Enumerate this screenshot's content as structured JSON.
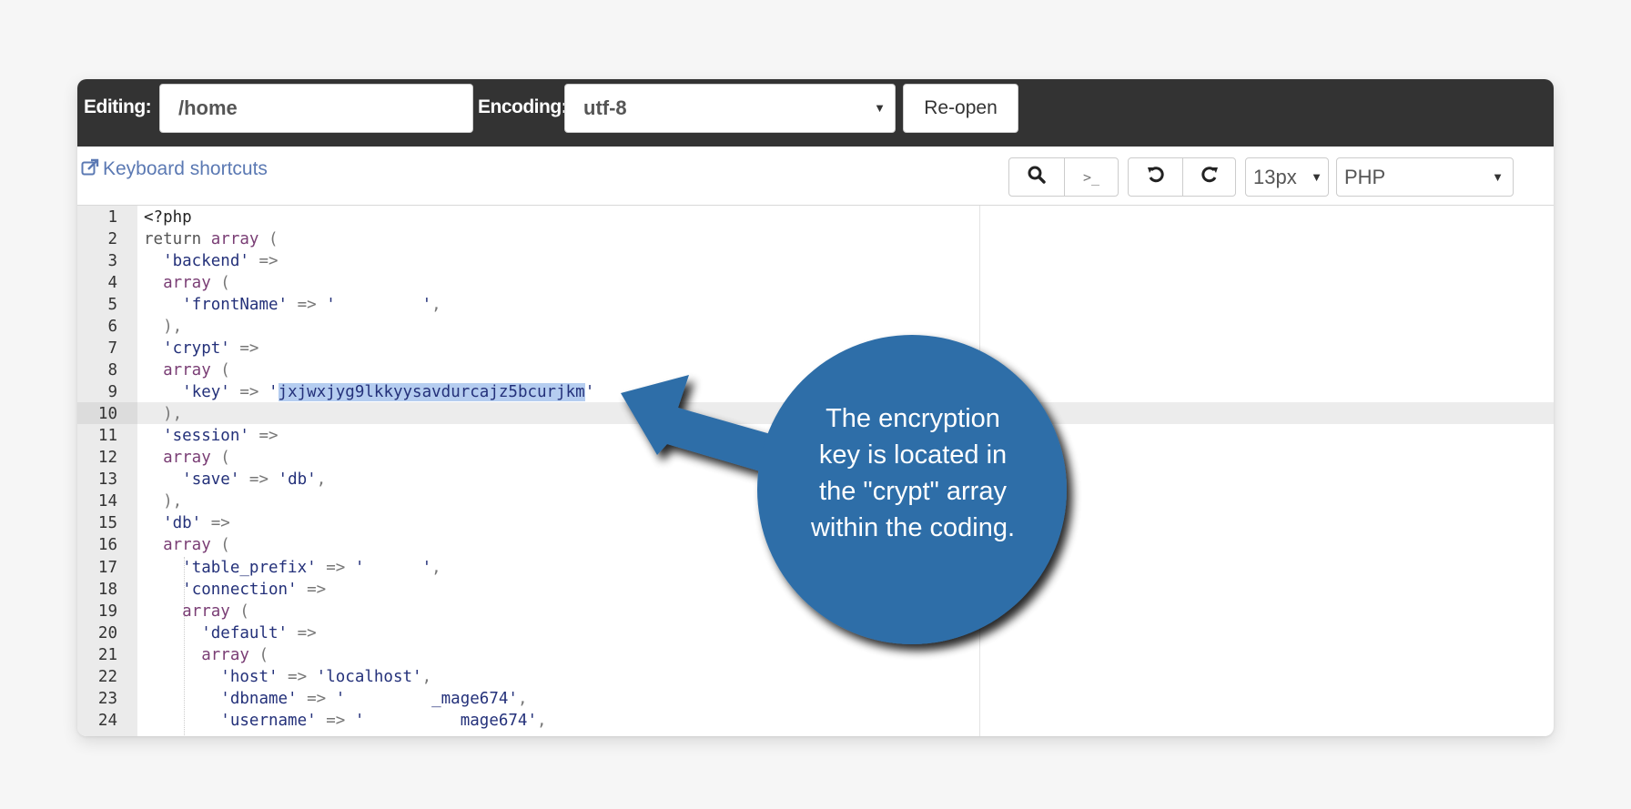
{
  "header": {
    "editing_label": "Editing:",
    "editing_path": "/home",
    "encoding_label": "Encoding:",
    "encoding_value": "utf-8",
    "reopen_label": "Re-open"
  },
  "toolbar": {
    "keyboard_shortcuts_label": "Keyboard shortcuts",
    "search_icon": "search-icon",
    "terminal_icon": "terminal-icon",
    "terminal_glyph": ">_",
    "undo_icon": "undo-icon",
    "redo_icon": "redo-icon",
    "font_size_value": "13px",
    "language_value": "PHP"
  },
  "editor": {
    "active_line": 9,
    "lines": [
      {
        "n": "1",
        "tokens": [
          {
            "t": "tag",
            "v": "<?php"
          }
        ]
      },
      {
        "n": "2",
        "tokens": [
          {
            "t": "kw",
            "v": "return "
          },
          {
            "t": "fn",
            "v": "array"
          },
          {
            "t": "op",
            "v": " ("
          }
        ]
      },
      {
        "n": "3",
        "tokens": [
          {
            "t": "op",
            "v": "  "
          },
          {
            "t": "str",
            "v": "'backend'"
          },
          {
            "t": "op",
            "v": " =>"
          }
        ]
      },
      {
        "n": "4",
        "tokens": [
          {
            "t": "op",
            "v": "  "
          },
          {
            "t": "fn",
            "v": "array"
          },
          {
            "t": "op",
            "v": " ("
          }
        ]
      },
      {
        "n": "5",
        "tokens": [
          {
            "t": "op",
            "v": "    "
          },
          {
            "t": "str",
            "v": "'frontName'"
          },
          {
            "t": "op",
            "v": " => "
          },
          {
            "t": "str",
            "v": "'         '"
          },
          {
            "t": "op",
            "v": ","
          }
        ]
      },
      {
        "n": "6",
        "tokens": [
          {
            "t": "op",
            "v": "  ),"
          }
        ]
      },
      {
        "n": "7",
        "tokens": [
          {
            "t": "op",
            "v": "  "
          },
          {
            "t": "str",
            "v": "'crypt'"
          },
          {
            "t": "op",
            "v": " =>"
          }
        ]
      },
      {
        "n": "8",
        "tokens": [
          {
            "t": "op",
            "v": "  "
          },
          {
            "t": "fn",
            "v": "array"
          },
          {
            "t": "op",
            "v": " ("
          }
        ]
      },
      {
        "n": "9",
        "tokens": [
          {
            "t": "op",
            "v": "    "
          },
          {
            "t": "str",
            "v": "'key'"
          },
          {
            "t": "op",
            "v": " => "
          },
          {
            "t": "str",
            "v": "'"
          },
          {
            "t": "sel",
            "v": "jxjwxjyg9lkkyysavdurcajz5bcurjkm"
          },
          {
            "t": "str",
            "v": "'"
          }
        ]
      },
      {
        "n": "10",
        "tokens": [
          {
            "t": "op",
            "v": "  ),"
          }
        ]
      },
      {
        "n": "11",
        "tokens": [
          {
            "t": "op",
            "v": "  "
          },
          {
            "t": "str",
            "v": "'session'"
          },
          {
            "t": "op",
            "v": " =>"
          }
        ]
      },
      {
        "n": "12",
        "tokens": [
          {
            "t": "op",
            "v": "  "
          },
          {
            "t": "fn",
            "v": "array"
          },
          {
            "t": "op",
            "v": " ("
          }
        ]
      },
      {
        "n": "13",
        "tokens": [
          {
            "t": "op",
            "v": "    "
          },
          {
            "t": "str",
            "v": "'save'"
          },
          {
            "t": "op",
            "v": " => "
          },
          {
            "t": "str",
            "v": "'db'"
          },
          {
            "t": "op",
            "v": ","
          }
        ]
      },
      {
        "n": "14",
        "tokens": [
          {
            "t": "op",
            "v": "  ),"
          }
        ]
      },
      {
        "n": "15",
        "tokens": [
          {
            "t": "op",
            "v": "  "
          },
          {
            "t": "str",
            "v": "'db'"
          },
          {
            "t": "op",
            "v": " =>"
          }
        ]
      },
      {
        "n": "16",
        "tokens": [
          {
            "t": "op",
            "v": "  "
          },
          {
            "t": "fn",
            "v": "array"
          },
          {
            "t": "op",
            "v": " ("
          }
        ]
      },
      {
        "n": "17",
        "tokens": [
          {
            "t": "op",
            "v": "    "
          },
          {
            "t": "str",
            "v": "'table_prefix'"
          },
          {
            "t": "op",
            "v": " => "
          },
          {
            "t": "str",
            "v": "'      '"
          },
          {
            "t": "op",
            "v": ","
          }
        ]
      },
      {
        "n": "18",
        "tokens": [
          {
            "t": "op",
            "v": "    "
          },
          {
            "t": "str",
            "v": "'connection'"
          },
          {
            "t": "op",
            "v": " =>"
          }
        ]
      },
      {
        "n": "19",
        "tokens": [
          {
            "t": "op",
            "v": "    "
          },
          {
            "t": "fn",
            "v": "array"
          },
          {
            "t": "op",
            "v": " ("
          }
        ]
      },
      {
        "n": "20",
        "tokens": [
          {
            "t": "op",
            "v": "      "
          },
          {
            "t": "str",
            "v": "'default'"
          },
          {
            "t": "op",
            "v": " =>"
          }
        ]
      },
      {
        "n": "21",
        "tokens": [
          {
            "t": "op",
            "v": "      "
          },
          {
            "t": "fn",
            "v": "array"
          },
          {
            "t": "op",
            "v": " ("
          }
        ]
      },
      {
        "n": "22",
        "tokens": [
          {
            "t": "op",
            "v": "        "
          },
          {
            "t": "str",
            "v": "'host'"
          },
          {
            "t": "op",
            "v": " => "
          },
          {
            "t": "str",
            "v": "'localhost'"
          },
          {
            "t": "op",
            "v": ","
          }
        ]
      },
      {
        "n": "23",
        "tokens": [
          {
            "t": "op",
            "v": "        "
          },
          {
            "t": "str",
            "v": "'dbname'"
          },
          {
            "t": "op",
            "v": " => "
          },
          {
            "t": "str",
            "v": "'         _mage674'"
          },
          {
            "t": "op",
            "v": ","
          }
        ]
      },
      {
        "n": "24",
        "tokens": [
          {
            "t": "op",
            "v": "        "
          },
          {
            "t": "str",
            "v": "'username'"
          },
          {
            "t": "op",
            "v": " => "
          },
          {
            "t": "str",
            "v": "'          mage674'"
          },
          {
            "t": "op",
            "v": ","
          }
        ]
      }
    ]
  },
  "callout": {
    "text_lines": [
      "The encryption",
      "key is located in",
      "the \"crypt\" array",
      "within the coding."
    ],
    "color": "#2f6ea8"
  }
}
